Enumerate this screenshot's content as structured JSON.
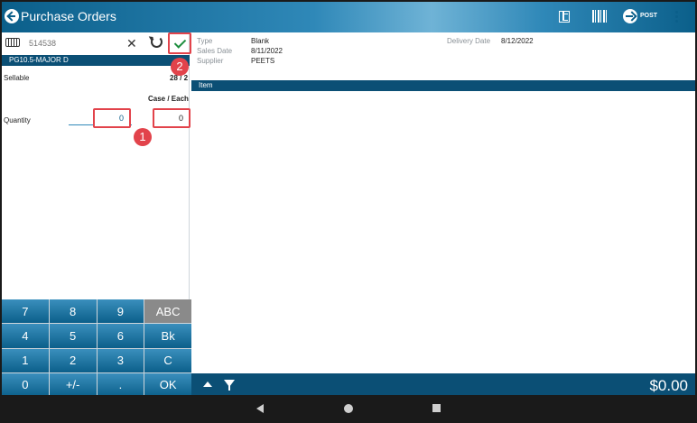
{
  "app": {
    "title": "Purchase Orders",
    "post_label": "POST"
  },
  "left": {
    "search": {
      "placeholder": "514538"
    },
    "clear_glyph": "✕",
    "item_code": "PG10.5-MAJOR D",
    "sellable_label": "Sellable",
    "sellable_value": "28 / 2",
    "case_each_label": "Case / Each",
    "quantity_label": "Quantity",
    "quantity_case": "0",
    "quantity_each": "0"
  },
  "callouts": {
    "one": "1",
    "two": "2"
  },
  "keypad": {
    "keys": [
      "7",
      "8",
      "9",
      "ABC",
      "4",
      "5",
      "6",
      "Bk",
      "1",
      "2",
      "3",
      "C",
      "0",
      "+/-",
      ".",
      "OK"
    ]
  },
  "details": {
    "type_label": "Type",
    "type_value": "Blank",
    "sales_date_label": "Sales Date",
    "sales_date_value": "8/11/2022",
    "supplier_label": "Supplier",
    "supplier_value": "PEETS",
    "delivery_date_label": "Delivery Date",
    "delivery_date_value": "8/12/2022",
    "item_header": "Item"
  },
  "footer": {
    "total": "$0.00"
  },
  "colors": {
    "primary": "#0b5f8a",
    "header_dark": "#0b4f75",
    "highlight": "#e2434b",
    "check": "#1e8e3e"
  }
}
